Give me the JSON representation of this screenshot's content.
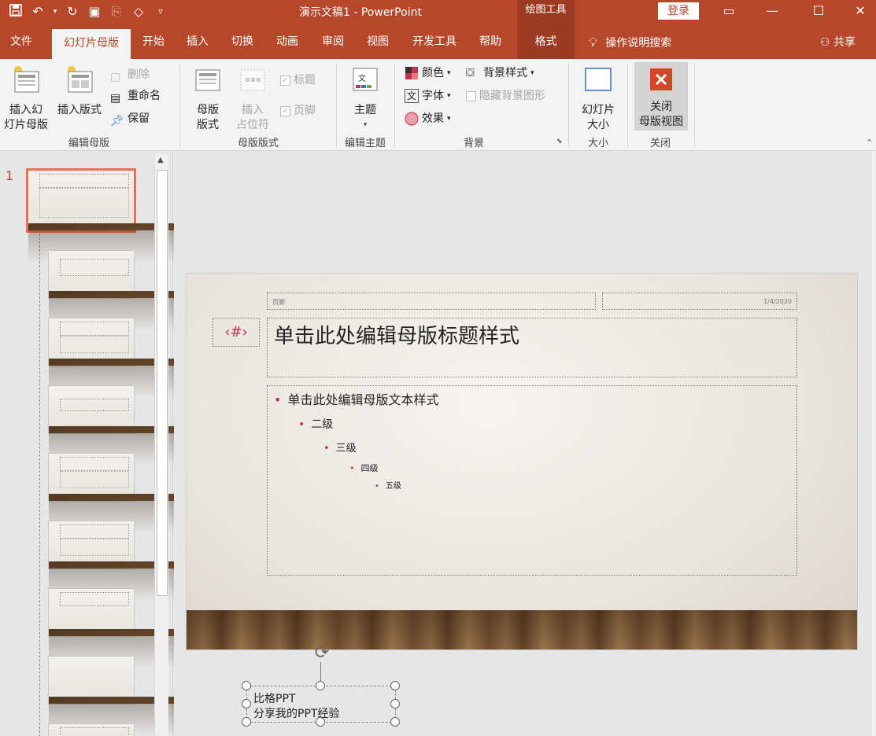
{
  "window": {
    "title": "演示文稿1  -  PowerPoint",
    "context_tools": "绘图工具",
    "login": "登录"
  },
  "tabs": {
    "file": "文件",
    "slide_master": "幻灯片母版",
    "home": "开始",
    "insert": "插入",
    "transitions": "切换",
    "animations": "动画",
    "review": "审阅",
    "view": "视图",
    "developer": "开发工具",
    "help": "帮助",
    "format": "格式",
    "search": "操作说明搜索",
    "share": "共享"
  },
  "ribbon": {
    "edit_master": {
      "label": "编辑母版",
      "insert_slide_master": "插入幻\n灯片母版",
      "insert_layout": "插入版式",
      "delete": "删除",
      "rename": "重命名",
      "preserve": "保留"
    },
    "master_layout": {
      "label": "母版版式",
      "master_layout_btn": "母版\n版式",
      "insert_placeholder": "插入\n占位符",
      "title_check": "标题",
      "footer_check": "页脚"
    },
    "edit_theme": {
      "label": "编辑主题",
      "themes": "主题"
    },
    "background": {
      "label": "背景",
      "colors": "颜色",
      "fonts": "字体",
      "effects": "效果",
      "background_styles": "背景样式",
      "hide_background_graphics": "隐藏背景图形"
    },
    "size": {
      "label": "大小",
      "slide_size": "幻灯片\n大小"
    },
    "close": {
      "label": "关闭",
      "close_master_view": "关闭\n母版视图"
    }
  },
  "thumbnails": {
    "slide_number": "1"
  },
  "slide": {
    "footer": "页脚",
    "date": "1/4/2020",
    "number": "‹#›",
    "title": "单击此处编辑母版标题样式",
    "body": {
      "level1": "单击此处编辑母版文本样式",
      "level2": "二级",
      "level3": "三级",
      "level4": "四级",
      "level5": "五级"
    }
  },
  "textbox": {
    "line1": "比格PPT",
    "line2": "分享我的PPT经验"
  },
  "colors": {
    "accent": "#b7472a",
    "context": "#9c3a22",
    "bullet": "#c0324d"
  }
}
